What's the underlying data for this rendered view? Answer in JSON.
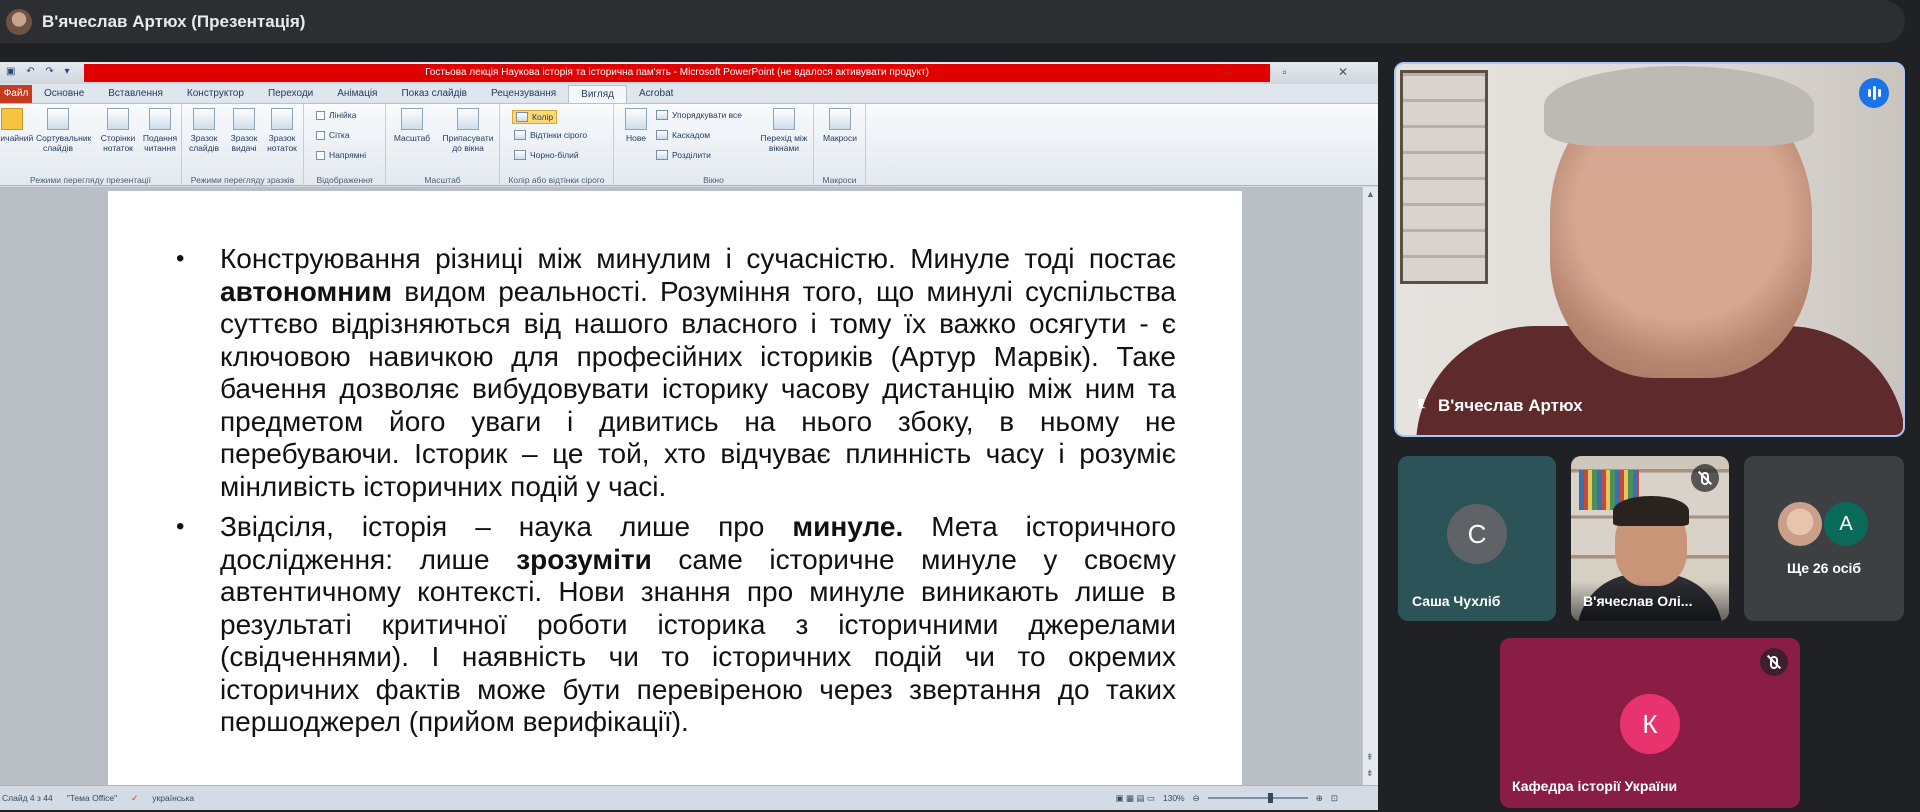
{
  "meet": {
    "presenter_title": "В'ячеслав Артюх (Презентація)",
    "main_speaker_name": "В'ячеслав Артюх",
    "participants": [
      {
        "initial": "С",
        "name": "Саша Чухліб",
        "color": "#5f6368"
      },
      {
        "initial": "",
        "name": "В'ячеслав Олі...",
        "color": "#3a3b3f"
      },
      {
        "initial": "А",
        "name": "Ще 26 осіб",
        "color": "#0b6b5a"
      },
      {
        "initial": "К",
        "name": "Кафедра історії України",
        "color": "#e8336f"
      }
    ]
  },
  "ppt": {
    "window_title": "Гостьова лекція Наукова історія та історична пам'ять - Microsoft PowerPoint (не вдалося активувати продукт)",
    "tabs": [
      "Файл",
      "Основне",
      "Вставлення",
      "Конструктор",
      "Переходи",
      "Анімація",
      "Показ слайдів",
      "Рецензування",
      "Вигляд",
      "Acrobat"
    ],
    "active_tab": "Вигляд",
    "ribbon": {
      "group1": {
        "label": "Режими перегляду презентації",
        "buttons": [
          "Звичайний",
          "Сортувальник слайдів",
          "Сторінки нотаток",
          "Подання читання"
        ]
      },
      "group2": {
        "label": "Режими перегляду зразків",
        "buttons": [
          "Зразок слайдів",
          "Зразок видачі",
          "Зразок нотаток"
        ]
      },
      "group3": {
        "label": "Відображення",
        "checks": [
          "Лінійка",
          "Сітка",
          "Напрямні"
        ]
      },
      "group4": {
        "label": "Масштаб",
        "buttons": [
          "Масштаб",
          "Припасувати до вікна"
        ]
      },
      "group5": {
        "label": "Колір або відтінки сірого",
        "items": [
          "Колір",
          "Відтінки сірого",
          "Чорно-білий"
        ]
      },
      "group6": {
        "label": "Вікно",
        "buttons": [
          "Нове"
        ],
        "items": [
          "Упорядкувати все",
          "Каскадом",
          "Розділити"
        ],
        "switch": "Перехід між вікнами"
      },
      "group7": {
        "label": "Макроси",
        "buttons": [
          "Макроси"
        ]
      }
    },
    "status": {
      "slide": "Слайд 4 з 44",
      "theme": "\"Тема Office\"",
      "language": "українська",
      "zoom": "130%"
    },
    "slide": {
      "bullet1": {
        "p1": "Конструювання різниці між минулим і сучасністю. Минуле тоді постає ",
        "b1": "автономним",
        "p2": " видом реальності. Розуміння того, що минулі суспільства суттєво відрізняються від нашого власного і тому їх важко осягути - є ключовою навичкою для професійних істориків (Артур Марвік). Таке бачення дозволяє вибудовувати історику часову дистанцію між ним та предметом його уваги і дивитись на нього збоку, в ньому не перебуваючи. Історик – це той, хто відчуває плинність часу і розуміє мінливість історичних подій у часі."
      },
      "bullet2": {
        "p1": "Звідсіля, історія – наука лише про ",
        "b1": "минуле.",
        "p2": " Мета історичного дослідження: лише ",
        "b2": "зрозуміти",
        "p3": " саме історичне минуле у своєму автентичному контексті. Нови знання про минуле виникають лише в результаті критичної роботи історика з історичними джерелами (свідченнями). І наявність чи то історичних подій чи то окремих історичних фактів може бути перевіреною через звертання до таких першоджерел (прийом верифікації)."
      }
    }
  }
}
